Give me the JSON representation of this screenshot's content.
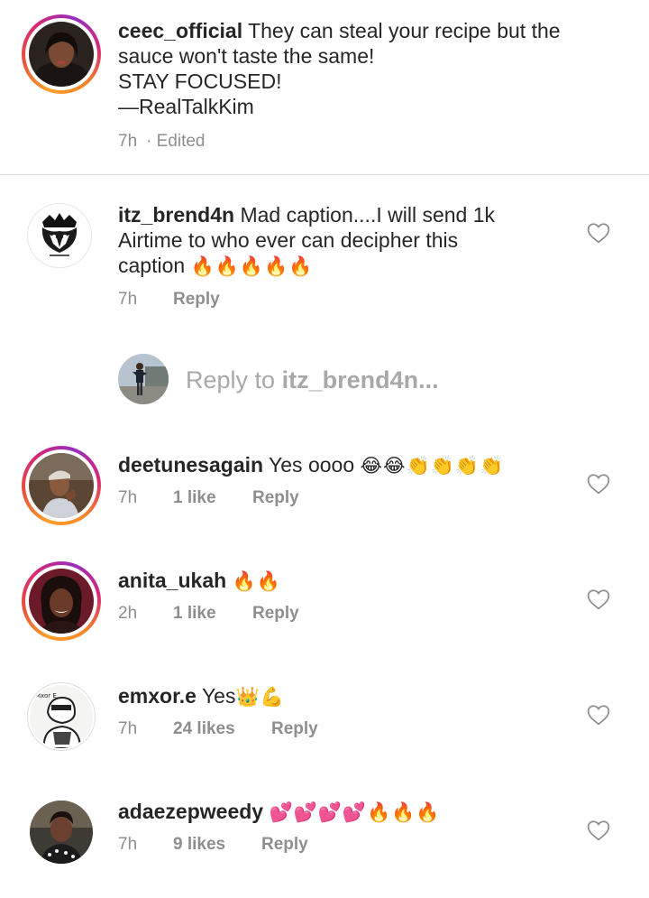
{
  "caption": {
    "username": "ceec_official",
    "lines": [
      "They can steal your recipe but the",
      "sauce won't taste the same!",
      "STAY FOCUSED!",
      "—RealTalkKim"
    ],
    "time": "7h",
    "edited": "· Edited"
  },
  "reply_composer": {
    "prefix": "Reply to",
    "target": "itz_brend4n..."
  },
  "comments": [
    {
      "username": "itz_brend4n",
      "text_line1": "Mad caption....I will send 1k",
      "text_line2": "Airtime to who ever can decipher this",
      "text_line3": "caption",
      "emoji": "🔥🔥🔥🔥🔥",
      "time": "7h",
      "likes": "",
      "reply": "Reply"
    },
    {
      "username": "deetunesagain",
      "text": "Yes oooo",
      "emoji": "😂😂👏👏👏👏",
      "time": "7h",
      "likes": "1 like",
      "reply": "Reply"
    },
    {
      "username": "anita_ukah",
      "text": "",
      "emoji": "🔥🔥",
      "time": "2h",
      "likes": "1 like",
      "reply": "Reply"
    },
    {
      "username": "emxor.e",
      "text": "Yes",
      "emoji": "👑💪",
      "time": "7h",
      "likes": "24 likes",
      "reply": "Reply"
    },
    {
      "username": "adaezepweedy",
      "text": "",
      "emoji": "💕💕💕💕🔥🔥🔥",
      "time": "7h",
      "likes": "9 likes",
      "reply": "Reply"
    }
  ],
  "colors": {
    "text": "#262626",
    "muted": "#8e8e8e",
    "divider": "#dbdbdb",
    "story_ring": "#d62976"
  },
  "icons": {
    "like": "heart-outline-icon"
  }
}
